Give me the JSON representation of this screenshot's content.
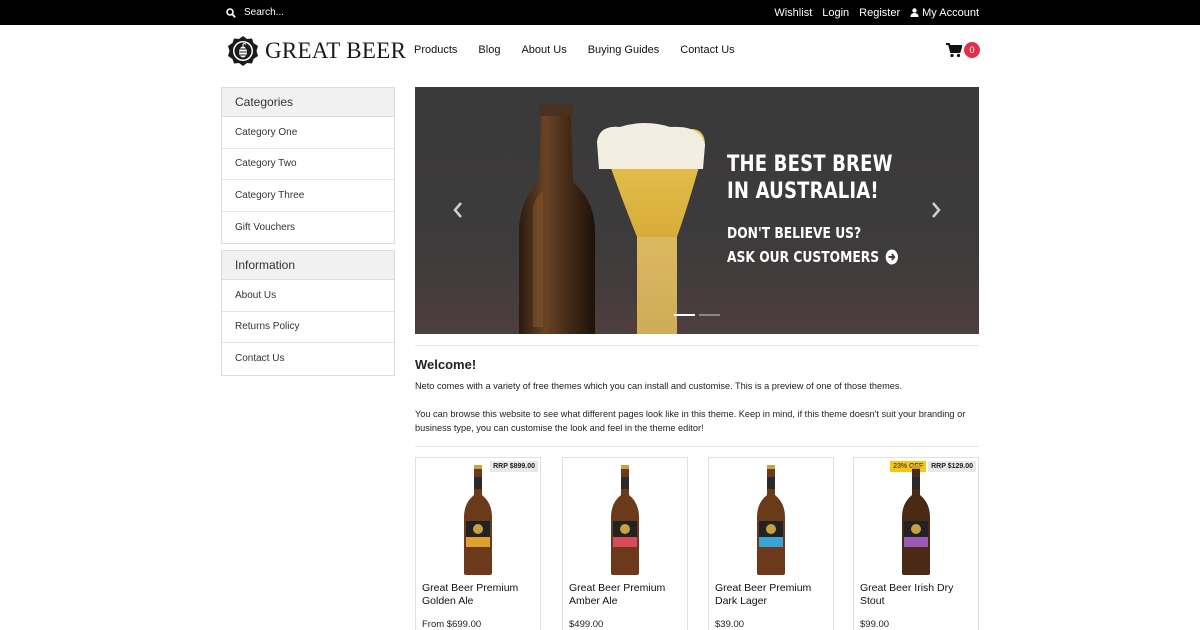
{
  "topbar": {
    "search_placeholder": "Search...",
    "links": {
      "wishlist": "Wishlist",
      "login": "Login",
      "register": "Register",
      "account": "My Account"
    }
  },
  "header": {
    "logo_text": "GREAT BEER",
    "nav": [
      "Products",
      "Blog",
      "About Us",
      "Buying Guides",
      "Contact Us"
    ],
    "cart_count": "0",
    "cart_badge_color": "#e0304a"
  },
  "sidebar": {
    "categories": {
      "title": "Categories",
      "items": [
        "Category One",
        "Category Two",
        "Category Three",
        "Gift Vouchers"
      ]
    },
    "information": {
      "title": "Information",
      "items": [
        "About Us",
        "Returns Policy",
        "Contact Us"
      ]
    }
  },
  "hero": {
    "headline_line1": "THE BEST BREW",
    "headline_line2": "IN AUSTRALIA!",
    "sub_line1": "DON'T BELIEVE US?",
    "sub_line2": "ASK OUR CUSTOMERS",
    "slide_count": 2,
    "active_slide": 1
  },
  "welcome": {
    "title": "Welcome!",
    "p1": "Neto comes with a variety of free themes which you can install and customise. This is a preview of one of those themes.",
    "p2": "You can browse this website to see what different pages look like in this theme. Keep in mind, if this theme doesn't suit your branding or business type, you can customise the look and feel in the theme editor!"
  },
  "products": [
    {
      "name": "Great Beer Premium Golden Ale",
      "price": "From $699.00",
      "rrp": "RRP $899.00",
      "discount": "",
      "label_color": "#e0a030"
    },
    {
      "name": "Great Beer Premium Amber Ale",
      "price": "$499.00",
      "rrp": "",
      "discount": "",
      "label_color": "#d94a5a"
    },
    {
      "name": "Great Beer Premium Dark Lager",
      "price": "$39.00",
      "rrp": "",
      "discount": "",
      "label_color": "#3aa3d8"
    },
    {
      "name": "Great Beer Irish Dry Stout",
      "price": "$99.00",
      "rrp": "RRP $129.00",
      "discount": "23% OFF",
      "label_color": "#9a5ab8"
    }
  ]
}
